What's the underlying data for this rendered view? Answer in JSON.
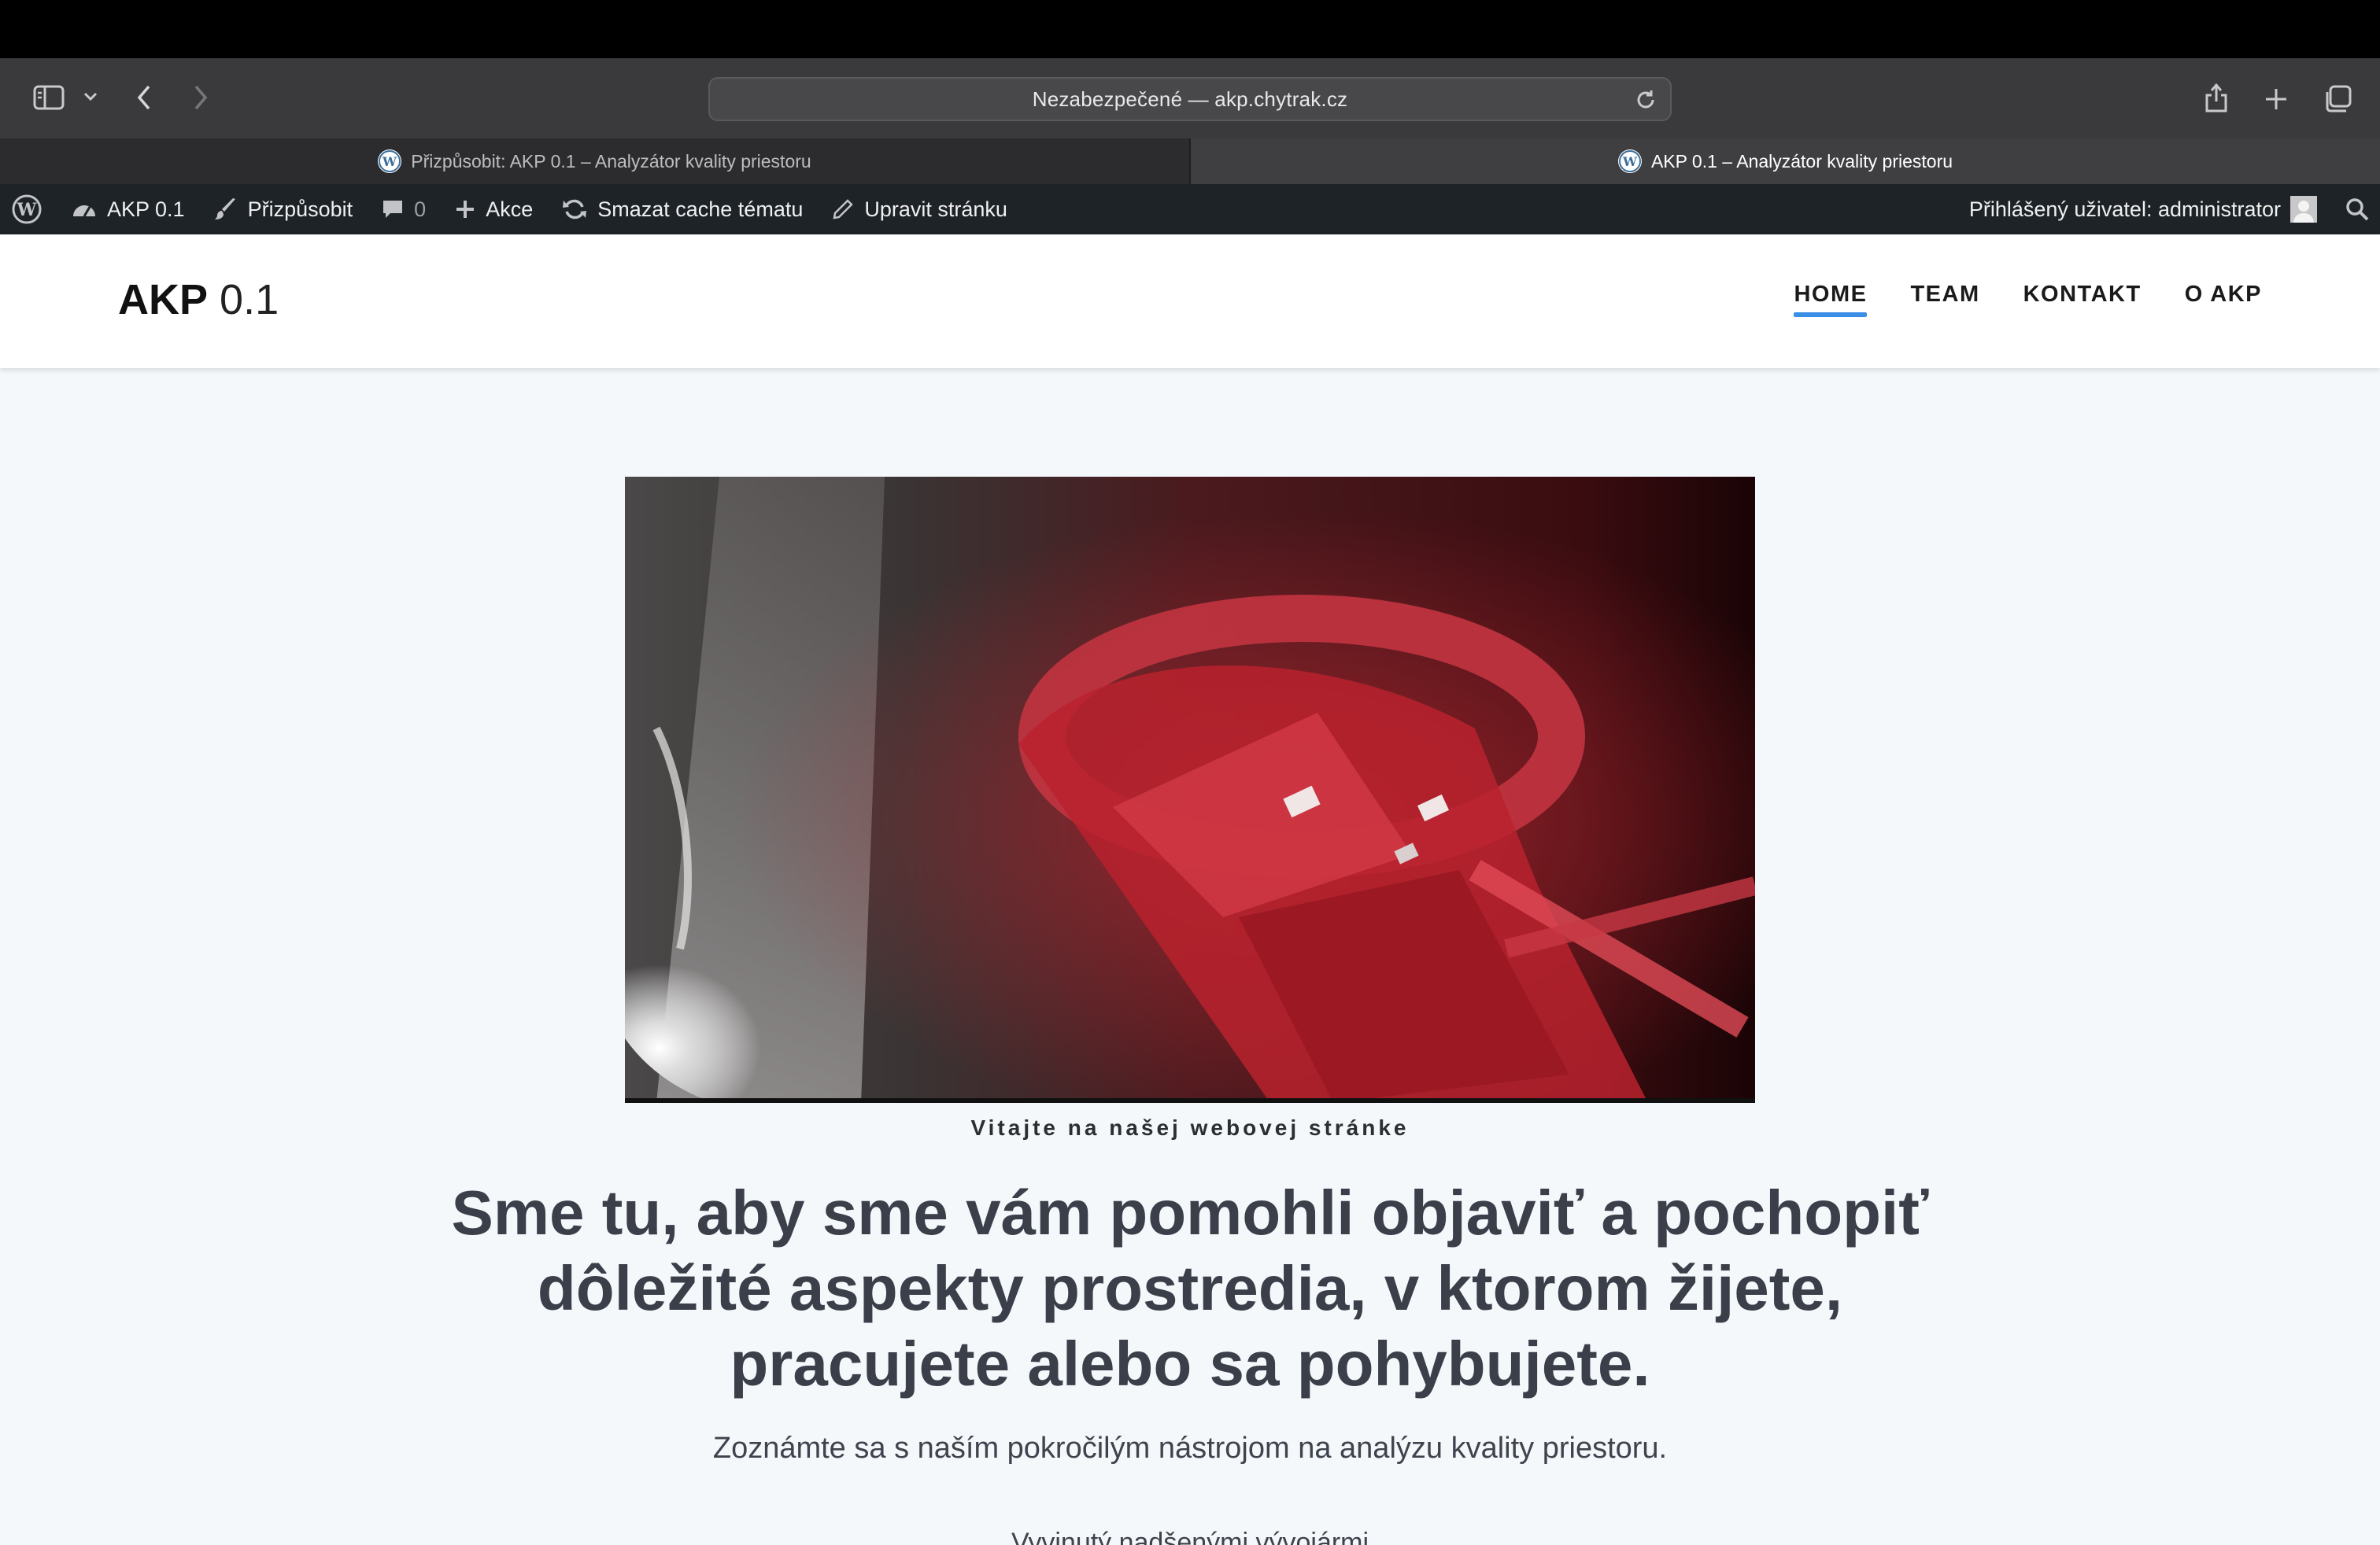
{
  "browser": {
    "address": "Nezabezpečené — akp.chytrak.cz",
    "tabs": [
      {
        "label": "Přizpůsobit: AKP 0.1 – Analyzátor kvality priestoru",
        "active": false
      },
      {
        "label": "AKP 0.1 – Analyzátor kvality priestoru",
        "active": true
      }
    ]
  },
  "adminbar": {
    "site": "AKP 0.1",
    "customize": "Přizpůsobit",
    "comments": "0",
    "new": "Akce",
    "clear_cache": "Smazat cache tématu",
    "edit_page": "Upravit stránku",
    "user": "Přihlášený uživatel: administrator"
  },
  "site": {
    "logo_bold": "AKP",
    "logo_light": "0.1",
    "nav": [
      {
        "label": "HOME",
        "current": true
      },
      {
        "label": "TEAM",
        "current": false
      },
      {
        "label": "KONTAKT",
        "current": false
      },
      {
        "label": "O AKP",
        "current": false
      }
    ]
  },
  "hero": {
    "eyebrow": "Vitajte na našej webovej stránke",
    "headline": "Sme tu, aby sme vám pomohli objaviť a pochopiť dôležité aspekty prostredia, v ktorom žijete, pracujete alebo sa pohybujete.",
    "subline": "Zoznámte sa s naším pokročilým nástrojom na analýzu kvality priestoru.",
    "cut_text": "Vyvinutý nadšenými vývojármi"
  },
  "colors": {
    "accent": "#3a8ee6",
    "adminbar_bg": "#1d2327",
    "page_bg": "#f5f8fb"
  }
}
